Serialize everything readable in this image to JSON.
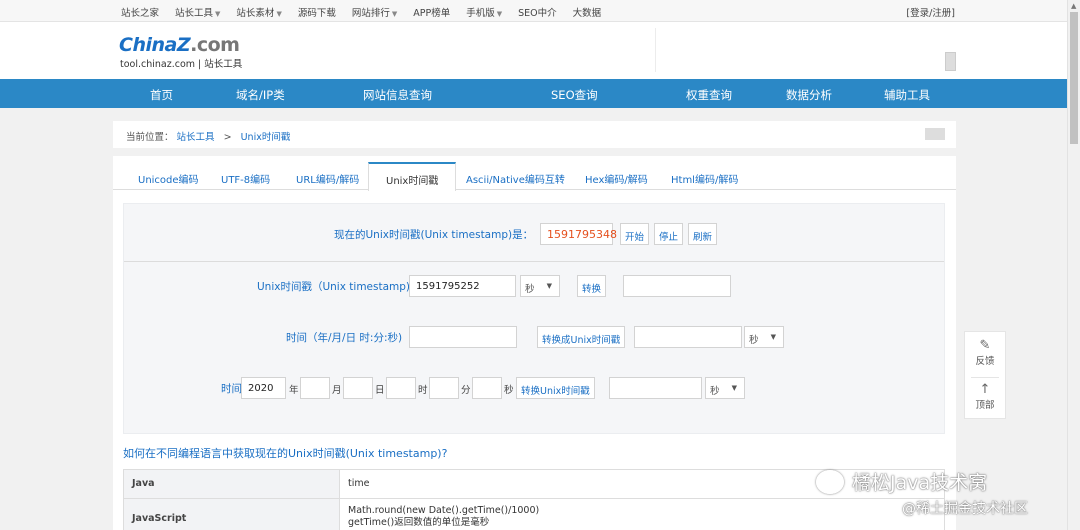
{
  "topbar": {
    "nav": [
      {
        "label": "站长之家",
        "dropdown": false
      },
      {
        "label": "站长工具",
        "dropdown": true
      },
      {
        "label": "站长素材",
        "dropdown": true
      },
      {
        "label": "源码下载",
        "dropdown": false
      },
      {
        "label": "网站排行",
        "dropdown": true
      },
      {
        "label": "APP榜单",
        "dropdown": false
      },
      {
        "label": "手机版",
        "dropdown": true
      },
      {
        "label": "SEO中介",
        "dropdown": false
      },
      {
        "label": "大数据",
        "dropdown": false
      }
    ],
    "login": "[登录/注册]"
  },
  "logo": {
    "main_a": "China",
    "main_z": "Z",
    "main_b": ".com",
    "sub": "tool.chinaz.com | 站长工具"
  },
  "mainnav": [
    "首页",
    "域名/IP类",
    "网站信息查询",
    "SEO查询",
    "权重查询",
    "数据分析",
    "辅助工具"
  ],
  "breadcrumb": {
    "prefix": "当前位置：",
    "link": "站长工具",
    "sep": ">",
    "current": "Unix时间戳"
  },
  "tabs": [
    "Unicode编码",
    "UTF-8编码",
    "URL编码/解码",
    "Unix时间戳",
    "Ascii/Native编码互转",
    "Hex编码/解码",
    "Html编码/解码"
  ],
  "tool": {
    "now_label": "现在的Unix时间戳(Unix timestamp)是：",
    "now_value": "1591795348",
    "start": "开始",
    "stop": "停止",
    "refresh": "刷新",
    "row1": {
      "label": "Unix时间戳（Unix timestamp)",
      "value": "1591795252",
      "unit": "秒",
      "button": "转换",
      "result": ""
    },
    "row2": {
      "label": "时间（年/月/日 时:分:秒)",
      "value": "",
      "button": "转换成Unix时间戳",
      "result": "",
      "unit": "秒"
    },
    "row3": {
      "label": "时间",
      "year": "2020",
      "year_u": "年",
      "month": "",
      "month_u": "月",
      "day": "",
      "day_u": "日",
      "hour": "",
      "hour_u": "时",
      "minute": "",
      "minute_u": "分",
      "second": "",
      "second_u": "秒",
      "button": "转换Unix时间戳",
      "result": "",
      "unit": "秒"
    }
  },
  "question": "如何在不同编程语言中获取现在的Unix时间戳(Unix timestamp)?",
  "table": [
    {
      "lang": "Java",
      "code": [
        "time"
      ]
    },
    {
      "lang": "JavaScript",
      "code": [
        "Math.round(new Date().getTime()/1000)",
        "getTime()返回数值的单位是毫秒"
      ]
    }
  ],
  "float": {
    "feedback": "反馈",
    "top": "顶部"
  },
  "watermark": {
    "line1": "橘松Java技术窝",
    "line2": "@稀土掘金技术社区"
  }
}
